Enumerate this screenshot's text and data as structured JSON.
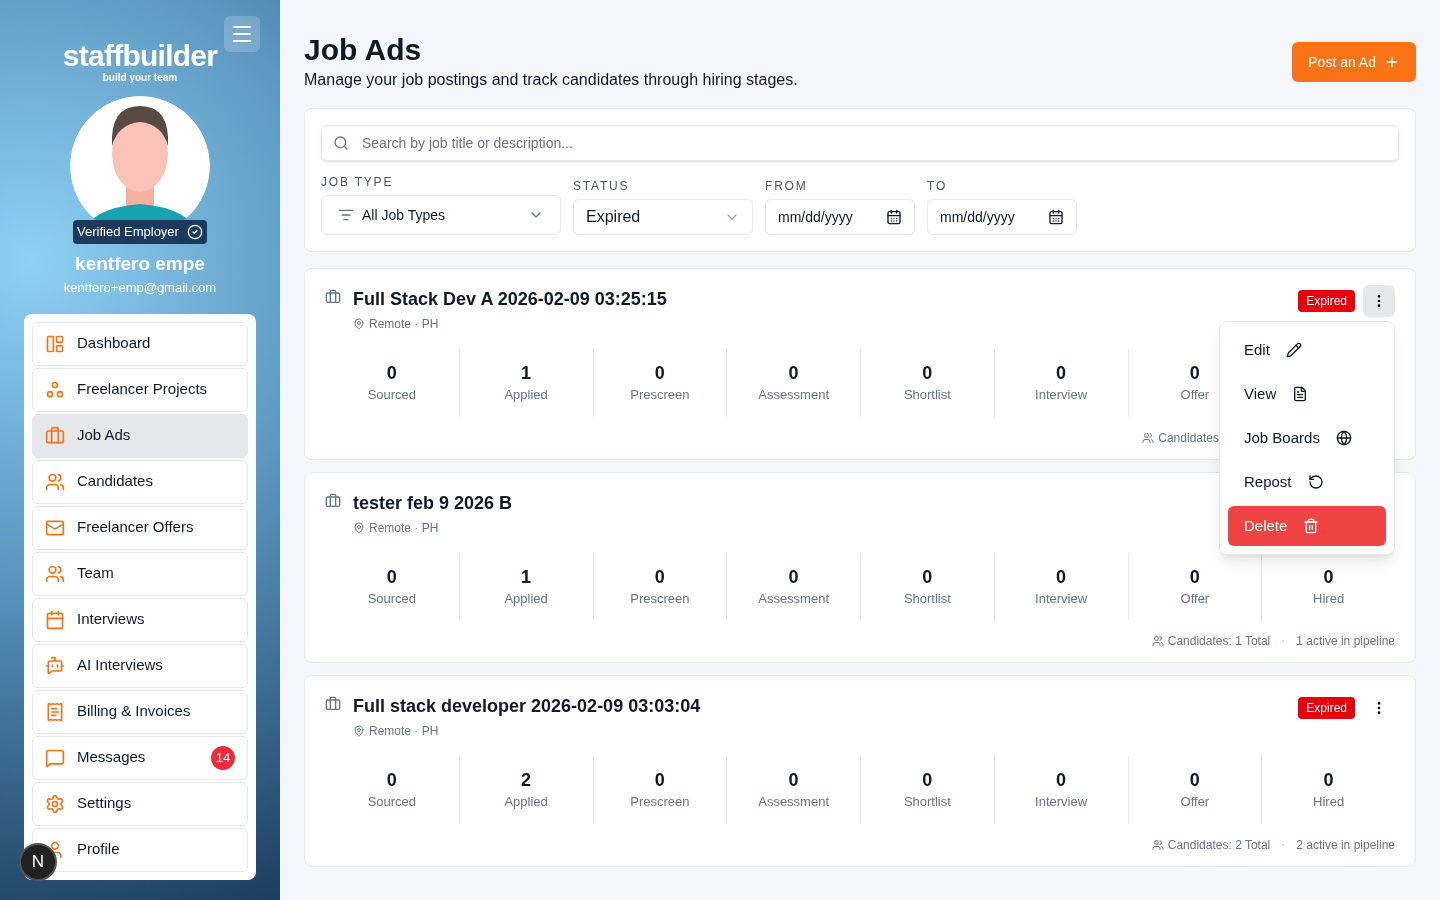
{
  "sidebar": {
    "logo": "staffbuilder",
    "tagline": "build your team",
    "badge": "Verified Employer",
    "name": "kentfero empe",
    "email": "kentfero+emp@gmail.com",
    "items": [
      {
        "label": "Dashboard",
        "kind": "dashboard",
        "selected": false
      },
      {
        "label": "Freelancer Projects",
        "kind": "projects",
        "selected": false
      },
      {
        "label": "Job Ads",
        "kind": "jobs",
        "selected": true
      },
      {
        "label": "Candidates",
        "kind": "people",
        "selected": false
      },
      {
        "label": "Freelancer Offers",
        "kind": "mail",
        "selected": false
      },
      {
        "label": "Team",
        "kind": "people",
        "selected": false
      },
      {
        "label": "Interviews",
        "kind": "calendar",
        "selected": false
      },
      {
        "label": "AI Interviews",
        "kind": "bot",
        "selected": false
      },
      {
        "label": "Billing & Invoices",
        "kind": "receipt",
        "selected": false
      },
      {
        "label": "Messages",
        "kind": "chat",
        "selected": false,
        "count": "14"
      },
      {
        "label": "Settings",
        "kind": "gear",
        "selected": false
      },
      {
        "label": "Profile",
        "kind": "user",
        "selected": false
      }
    ],
    "dev_badge": "N"
  },
  "header": {
    "title": "Job Ads",
    "subtitle": "Manage your job postings and track candidates through hiring stages.",
    "post_button": "Post an Ad"
  },
  "filters": {
    "search": {
      "placeholder": "Search by job title or description..."
    },
    "job_type": {
      "label": "JOB TYPE",
      "value": "All Job Types"
    },
    "status": {
      "label": "STATUS",
      "value": "Expired"
    },
    "from": {
      "label": "FROM",
      "placeholder": "mm/dd/yyyy"
    },
    "to": {
      "label": "TO",
      "placeholder": "mm/dd/yyyy"
    }
  },
  "jobs": [
    {
      "title": "Full Stack Dev A 2026-02-09 03:25:15",
      "location": "Remote · PH",
      "status": "Expired",
      "menu_open": true,
      "stages": [
        {
          "count": "0",
          "label": "Sourced"
        },
        {
          "count": "1",
          "label": "Applied"
        },
        {
          "count": "0",
          "label": "Prescreen"
        },
        {
          "count": "0",
          "label": "Assessment"
        },
        {
          "count": "0",
          "label": "Shortlist"
        },
        {
          "count": "0",
          "label": "Interview"
        },
        {
          "count": "0",
          "label": "Offer"
        }
      ],
      "candidates": "Candidates"
    },
    {
      "title": "tester feb 9 2026 B",
      "location": "Remote · PH",
      "menu_open": false,
      "stages": [
        {
          "count": "0",
          "label": "Sourced"
        },
        {
          "count": "1",
          "label": "Applied"
        },
        {
          "count": "0",
          "label": "Prescreen"
        },
        {
          "count": "0",
          "label": "Assessment"
        },
        {
          "count": "0",
          "label": "Shortlist"
        },
        {
          "count": "0",
          "label": "Interview"
        },
        {
          "count": "0",
          "label": "Offer"
        },
        {
          "count": "0",
          "label": "Hired"
        }
      ],
      "candidates": "Candidates: 1 Total",
      "pipeline": "1 active in pipeline"
    },
    {
      "title": "Full stack developer 2026-02-09 03:03:04",
      "location": "Remote · PH",
      "status": "Expired",
      "menu_open": false,
      "stages": [
        {
          "count": "0",
          "label": "Sourced"
        },
        {
          "count": "2",
          "label": "Applied"
        },
        {
          "count": "0",
          "label": "Prescreen"
        },
        {
          "count": "0",
          "label": "Assessment"
        },
        {
          "count": "0",
          "label": "Shortlist"
        },
        {
          "count": "0",
          "label": "Interview"
        },
        {
          "count": "0",
          "label": "Offer"
        },
        {
          "count": "0",
          "label": "Hired"
        }
      ],
      "candidates": "Candidates: 2 Total",
      "pipeline": "2 active in pipeline"
    }
  ],
  "menu": [
    {
      "label": "Edit",
      "kind": "edit"
    },
    {
      "label": "View",
      "kind": "view"
    },
    {
      "label": "Job Boards",
      "kind": "boards"
    },
    {
      "label": "Repost",
      "kind": "repost"
    },
    {
      "label": "Delete",
      "kind": "delete"
    }
  ]
}
